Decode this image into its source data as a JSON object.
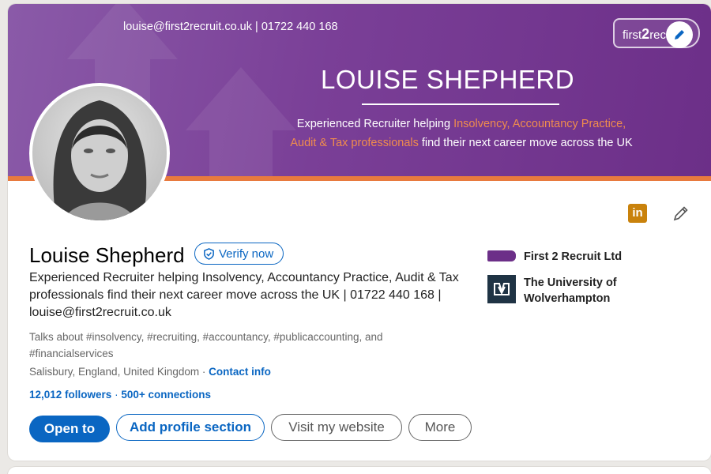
{
  "banner": {
    "contact": "louise@first2recruit.co.uk | 01722 440 168",
    "name": "LOUISE SHEPHERD",
    "tagline_part1": "Experienced Recruiter helping ",
    "tagline_highlight1": "Insolvency, Accountancy Practice,",
    "tagline_highlight2": "Audit & Tax professionals",
    "tagline_part2": " find their next career move across the UK",
    "brand_prefix": "first",
    "brand_number": "2",
    "brand_suffix": "rec"
  },
  "profile": {
    "name": "Louise Shepherd",
    "verify_label": "Verify now",
    "headline": "Experienced Recruiter helping Insolvency, Accountancy Practice, Audit & Tax professionals find their next career move across the UK | 01722 440 168 | louise@first2recruit.co.uk",
    "talks_about": "Talks about #insolvency, #recruiting, #accountancy, #publicaccounting, and #financialservices",
    "location": "Salisbury, England, United Kingdom",
    "separator": " · ",
    "contact_info_label": "Contact info",
    "followers": "12,012 followers",
    "stats_separator": " · ",
    "connections": "500+ connections"
  },
  "icons": {
    "linkedin_badge": "in"
  },
  "buttons": {
    "open_to": "Open to",
    "add_section": "Add profile section",
    "visit_website": "Visit my website",
    "more": "More"
  },
  "experience": {
    "company": "First 2 Recruit Ltd",
    "school_line1": "The University of",
    "school_line2": "Wolverhampton"
  },
  "colors": {
    "accent_blue": "#0a66c2",
    "banner_purple": "#7a3f97",
    "banner_orange": "#e87a3e"
  }
}
